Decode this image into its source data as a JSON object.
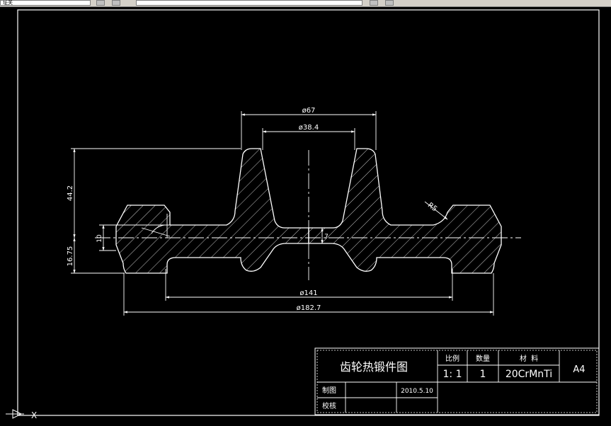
{
  "toolbar": {
    "layer_combo_value": "址关",
    "colors": {
      "background": "#d4d0c8",
      "border": "#808080"
    }
  },
  "drawing": {
    "title": "齿轮热锻件图",
    "colors": {
      "canvas": "#000000",
      "lines": "#ffffff"
    },
    "dimensions": {
      "top_outer_diameter": "ø67",
      "top_inner_diameter": "ø38.4",
      "hub_height": "44.2",
      "web_thickness": "10",
      "lower_height": "16.75",
      "center_offset": "7",
      "fillet_radius": "R5",
      "rim_diameter": "ø141",
      "overall_diameter": "ø182.7"
    }
  },
  "title_block": {
    "scale_label": "比例",
    "quantity_label": "数量",
    "material_label": "材  料",
    "scale_value": "1: 1",
    "quantity_value": "1",
    "material_value": "20CrMnTi",
    "sheet_size": "A4",
    "drawn_by_label": "制图",
    "checked_by_label": "校核",
    "date": "2010.5.10"
  },
  "ucs": {
    "axis_label": "X"
  }
}
